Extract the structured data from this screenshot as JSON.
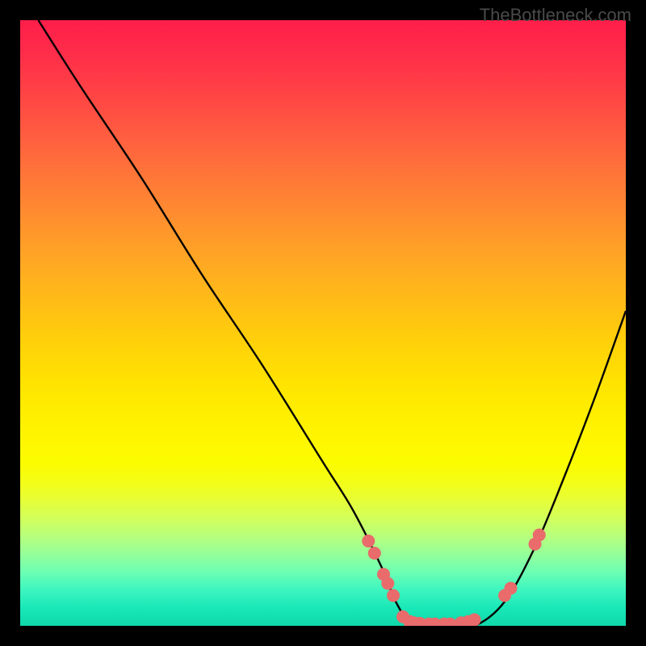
{
  "watermark": "TheBottleneck.com",
  "chart_data": {
    "type": "line",
    "title": "",
    "xlabel": "",
    "ylabel": "",
    "xlim": [
      0,
      100
    ],
    "ylim": [
      0,
      100
    ],
    "curve": {
      "x": [
        3,
        10,
        20,
        30,
        40,
        50,
        55,
        60,
        62,
        65,
        70,
        75,
        80,
        85,
        90,
        95,
        100
      ],
      "y": [
        100,
        89,
        74,
        58,
        43,
        27,
        19,
        9,
        4,
        0,
        0,
        0,
        4,
        13,
        25,
        38,
        52
      ]
    },
    "markers": [
      {
        "x": 57.5,
        "y": 14
      },
      {
        "x": 58.5,
        "y": 12
      },
      {
        "x": 60,
        "y": 8.5
      },
      {
        "x": 60.7,
        "y": 7
      },
      {
        "x": 61.6,
        "y": 5
      },
      {
        "x": 63.2,
        "y": 1.5
      },
      {
        "x": 64.3,
        "y": 0.7
      },
      {
        "x": 65,
        "y": 0.5
      },
      {
        "x": 66,
        "y": 0.4
      },
      {
        "x": 67.5,
        "y": 0.3
      },
      {
        "x": 68.5,
        "y": 0.3
      },
      {
        "x": 70,
        "y": 0.3
      },
      {
        "x": 71,
        "y": 0.3
      },
      {
        "x": 72.8,
        "y": 0.5
      },
      {
        "x": 74,
        "y": 0.7
      },
      {
        "x": 75,
        "y": 1
      },
      {
        "x": 80,
        "y": 5
      },
      {
        "x": 81,
        "y": 6.2
      },
      {
        "x": 85,
        "y": 13.5
      },
      {
        "x": 85.7,
        "y": 15
      }
    ],
    "marker_color": "#e96b6b",
    "marker_radius": 8
  }
}
